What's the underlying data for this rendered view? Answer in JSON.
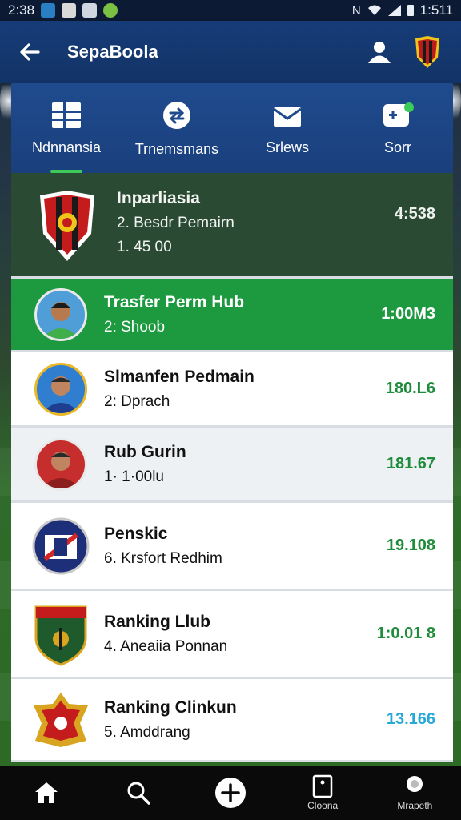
{
  "status_bar": {
    "time": "2:38",
    "right_time": "1:511"
  },
  "app_bar": {
    "title": "SepaBoola"
  },
  "tabs": [
    {
      "label": "Ndnnansia",
      "active": true
    },
    {
      "label": "Trnemsmans",
      "active": false
    },
    {
      "label": "Srlews",
      "active": false
    },
    {
      "label": "Sorr",
      "active": false
    }
  ],
  "items": [
    {
      "name": "Inparliasia",
      "line1": "2. Besdr Pemairn",
      "line2": "1. 45 00",
      "value": "4:538",
      "style": "dark"
    },
    {
      "name": "Trasfer Perm Hub",
      "line1": "2: Shoob",
      "value": "1:00M3",
      "style": "green"
    },
    {
      "name": "Slmanfen Pedmain",
      "line1": "2: Dprach",
      "value": "180.L6",
      "style": "white"
    },
    {
      "name": "Rub Gurin",
      "line1": "1· 1·00lu",
      "value": "181.67",
      "style": "grey"
    },
    {
      "name": "Penskic",
      "line1": "6. Krsfort Redhim",
      "value": "19.108",
      "style": "white"
    },
    {
      "name": "Ranking Llub",
      "line1": "4. Aneaiia Ponnan",
      "value": "1:0.01 8",
      "style": "white"
    },
    {
      "name": "Ranking Clinkun",
      "line1": "5. Amddrang",
      "value": "13.166",
      "style": "white",
      "value_color": "blue"
    }
  ],
  "bottom_nav": [
    {
      "icon": "home-icon",
      "label": ""
    },
    {
      "icon": "search-icon",
      "label": ""
    },
    {
      "icon": "add-icon",
      "label": ""
    },
    {
      "icon": "clipboard-icon",
      "label": "Cloona"
    },
    {
      "icon": "profile-icon",
      "label": "Mrapeth"
    }
  ],
  "colors": {
    "primary": "#163c78",
    "accent_green": "#1d9a3f",
    "value_green": "#1e8c3b",
    "value_blue": "#27a8d8"
  }
}
